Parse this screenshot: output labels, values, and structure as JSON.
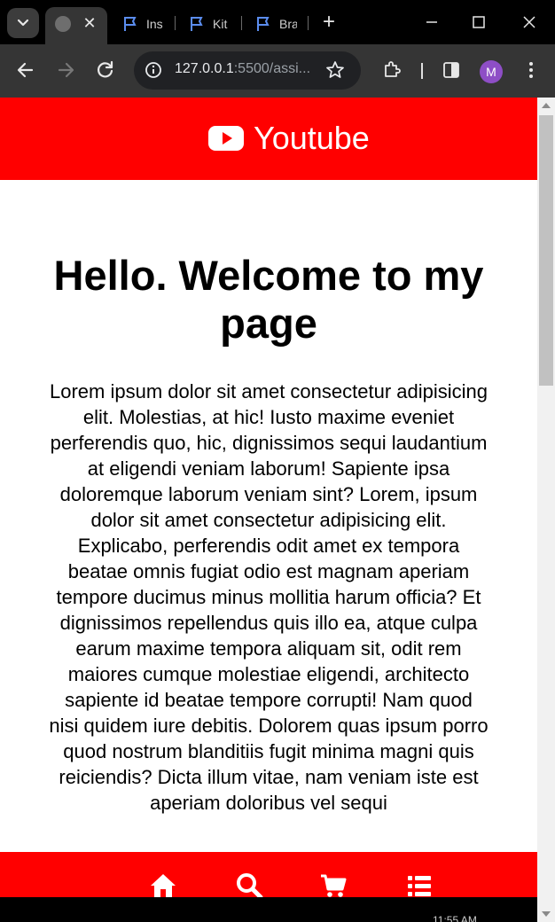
{
  "browser": {
    "tabs": [
      {
        "label": "Ins",
        "active": false
      },
      {
        "label": "Kit",
        "active": false
      },
      {
        "label": "Bra",
        "active": false
      }
    ],
    "active_tab_close": "✕",
    "new_tab": "+",
    "url_host": "127.0.0.1",
    "url_rest": ":5500/assi...",
    "profile_initial": "M"
  },
  "site": {
    "brand": "Youtube",
    "headline": "Hello. Welcome to my page",
    "body": "Lorem ipsum dolor sit amet consectetur adipisicing elit. Molestias, at hic! Iusto maxime eveniet perferendis quo, hic, dignissimos sequi laudantium at eligendi veniam laborum! Sapiente ipsa doloremque laborum veniam sint? Lorem, ipsum dolor sit amet consectetur adipisicing elit. Explicabo, perferendis odit amet ex tempora beatae omnis fugiat odio est magnam aperiam tempore ducimus minus mollitia harum officia? Et dignissimos repellendus quis illo ea, atque culpa earum maxime tempora aliquam sit, odit rem maiores cumque molestiae eligendi, architecto sapiente id beatae tempore corrupti! Nam quod nisi quidem iure debitis. Dolorem quas ipsum porro quod nostrum blanditiis fugit minima magni quis reiciendis? Dicta illum vitae, nam veniam iste est aperiam doloribus vel sequi",
    "bottom_nav": [
      "home-icon",
      "search-icon",
      "cart-icon",
      "list-icon"
    ]
  },
  "taskbar": {
    "clock": "11:55 AM"
  },
  "colors": {
    "brand_red": "#ff0000",
    "chrome_dark": "#353535"
  }
}
